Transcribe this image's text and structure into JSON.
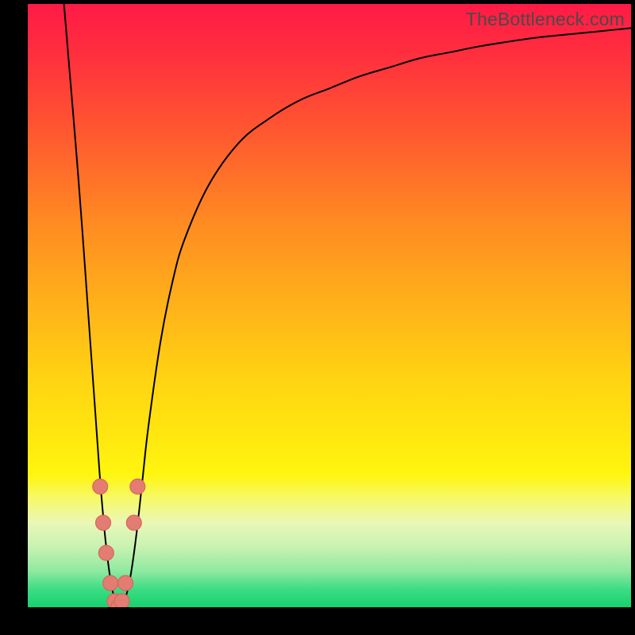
{
  "watermark": "TheBottleneck.com",
  "colors": {
    "frame": "#000000",
    "curve": "#000000",
    "dots": "#e37c72",
    "dots_stroke": "#d9655a"
  },
  "chart_data": {
    "type": "line",
    "title": "",
    "xlabel": "",
    "ylabel": "",
    "xlim": [
      0,
      100
    ],
    "ylim": [
      0,
      100
    ],
    "series": [
      {
        "name": "bottleneck-curve",
        "x": [
          6,
          7,
          8,
          9,
          10,
          11,
          12,
          13,
          14,
          15,
          16,
          17,
          18,
          19,
          20,
          22,
          24,
          26,
          30,
          35,
          40,
          45,
          50,
          55,
          60,
          65,
          70,
          75,
          80,
          85,
          90,
          95,
          100
        ],
        "y": [
          100,
          88,
          76,
          63,
          49,
          35,
          21,
          10,
          3,
          0,
          1,
          5,
          12,
          21,
          30,
          44,
          54,
          61,
          70,
          77,
          81,
          84,
          86,
          88,
          89.5,
          91,
          92,
          93,
          93.8,
          94.5,
          95,
          95.5,
          96
        ]
      }
    ],
    "markers": [
      {
        "x": 12.0,
        "y": 20
      },
      {
        "x": 12.5,
        "y": 14
      },
      {
        "x": 13.0,
        "y": 9
      },
      {
        "x": 13.7,
        "y": 4
      },
      {
        "x": 14.4,
        "y": 1
      },
      {
        "x": 15.0,
        "y": 0
      },
      {
        "x": 15.6,
        "y": 1
      },
      {
        "x": 16.2,
        "y": 4
      },
      {
        "x": 17.6,
        "y": 14
      },
      {
        "x": 18.2,
        "y": 20
      }
    ]
  }
}
